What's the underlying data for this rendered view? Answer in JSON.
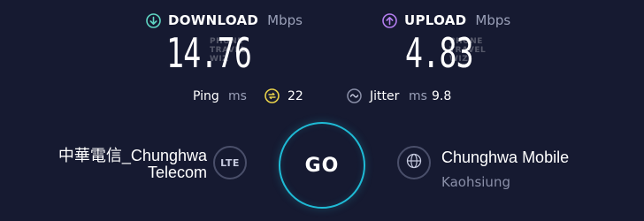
{
  "download": {
    "label": "DOWNLOAD",
    "unit": "Mbps",
    "value": "14.76",
    "icon": "download-arrow-icon",
    "color": "#5fd6c3",
    "watermark_line1": "PHONE",
    "watermark_line2": "TRAVEL",
    "watermark_line3": "WIZ"
  },
  "upload": {
    "label": "UPLOAD",
    "unit": "Mbps",
    "value": "4.83",
    "icon": "upload-arrow-icon",
    "color": "#b47ef0",
    "watermark_line1": "PHONE",
    "watermark_line2": "TRAVEL",
    "watermark_line3": "WIZ"
  },
  "ping": {
    "label": "Ping",
    "unit": "ms",
    "value": "22",
    "icon": "ping-icon",
    "color": "#e8d24a"
  },
  "jitter": {
    "label": "Jitter",
    "unit": "ms",
    "value": "9.8",
    "icon": "jitter-icon"
  },
  "isp": {
    "line1": "中華電信_Chunghwa",
    "line2": "Telecom",
    "badge": "LTE"
  },
  "go_button": {
    "label": "GO",
    "accent": "#1fbbd6"
  },
  "server": {
    "name": "Chunghwa Mobile",
    "location": "Kaohsiung",
    "icon": "globe-icon"
  }
}
